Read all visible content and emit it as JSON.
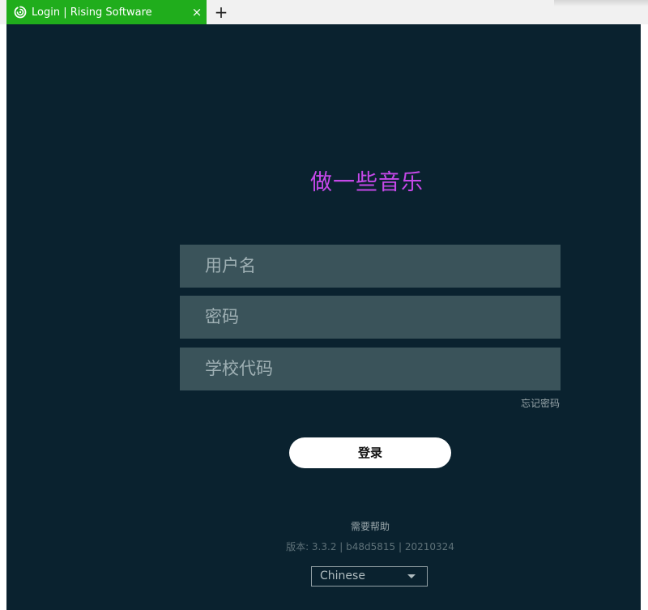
{
  "browser": {
    "tab_title": "Login | Rising Software",
    "tab_close": "×",
    "new_tab": "+"
  },
  "login": {
    "app_title": "做一些音乐",
    "username_placeholder": "用户名",
    "password_placeholder": "密码",
    "school_code_placeholder": "学校代码",
    "forgot_password": "忘记密码",
    "login_button": "登录",
    "help": "需要帮助",
    "version": "版本: 3.3.2 | b48d5815 | 20210324",
    "language": "Chinese"
  },
  "colors": {
    "tab_bg": "#20ad1c",
    "page_bg": "#0a222f",
    "title": "#c548e8",
    "field_bg": "#3a535a"
  }
}
